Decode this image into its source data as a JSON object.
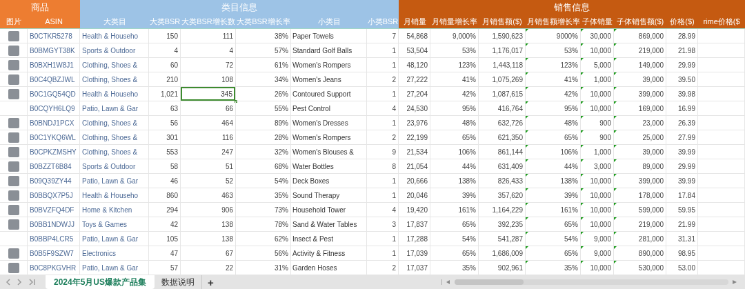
{
  "header_groups": [
    {
      "title": "商品",
      "color": "#ed7d31",
      "columns": [
        {
          "label": "图片",
          "kind": "photo"
        },
        {
          "label": "ASIN",
          "kind": "link_text"
        }
      ]
    },
    {
      "title": "类目信息",
      "color": "#9dc3e6",
      "columns": [
        {
          "label": "大类目",
          "kind": "link_text"
        },
        {
          "label": "大类BSR",
          "kind": "number"
        },
        {
          "label": "大类BSR增长数",
          "kind": "number"
        },
        {
          "label": "大类BSR增长率",
          "kind": "number"
        },
        {
          "label": "小类目",
          "kind": "text"
        },
        {
          "label": "小类BSR",
          "kind": "number"
        }
      ]
    },
    {
      "title": "销售信息",
      "color": "#c55a11",
      "columns": [
        {
          "label": "月销量",
          "kind": "number"
        },
        {
          "label": "月销量增长率",
          "kind": "number"
        },
        {
          "label": "月销售额($)",
          "kind": "number"
        },
        {
          "label": "月销售额增长率",
          "kind": "flagged_number"
        },
        {
          "label": "子体销量",
          "kind": "flagged_number"
        },
        {
          "label": "子体销售额($)",
          "kind": "flagged_number"
        },
        {
          "label": "价格($)",
          "kind": "number"
        },
        {
          "label": "rime价格($",
          "kind": "number"
        }
      ]
    }
  ],
  "rows": [
    {
      "photo": true,
      "cells": [
        {
          "text": "B0CTKR5278",
          "selected": false
        },
        {
          "text": "Health & Househo",
          "selected": false
        },
        {
          "text": "150",
          "selected": false
        },
        {
          "text": "111",
          "selected": false
        },
        {
          "text": "38%",
          "selected": false
        },
        {
          "text": "Paper Towels",
          "selected": false
        },
        {
          "text": "7",
          "selected": false
        },
        {
          "text": "54,868",
          "selected": false
        },
        {
          "text": "9,000%",
          "selected": false
        },
        {
          "text": "1,590,623",
          "selected": false
        },
        {
          "text": "9000%",
          "selected": false
        },
        {
          "text": "30,000",
          "selected": false
        },
        {
          "text": "869,000",
          "selected": false
        },
        {
          "text": "28.99",
          "selected": false
        }
      ]
    },
    {
      "photo": true,
      "cells": [
        {
          "text": "B0BMGYT38K",
          "selected": false
        },
        {
          "text": "Sports & Outdoor",
          "selected": false
        },
        {
          "text": "4",
          "selected": false
        },
        {
          "text": "4",
          "selected": false
        },
        {
          "text": "57%",
          "selected": false
        },
        {
          "text": "Standard Golf Balls",
          "selected": false
        },
        {
          "text": "1",
          "selected": false
        },
        {
          "text": "53,504",
          "selected": false
        },
        {
          "text": "53%",
          "selected": false
        },
        {
          "text": "1,176,017",
          "selected": false
        },
        {
          "text": "53%",
          "selected": false
        },
        {
          "text": "10,000",
          "selected": false
        },
        {
          "text": "219,000",
          "selected": false
        },
        {
          "text": "21.98",
          "selected": false
        }
      ]
    },
    {
      "photo": true,
      "cells": [
        {
          "text": "B0BXH1W8J1",
          "selected": false
        },
        {
          "text": "Clothing, Shoes &",
          "selected": false
        },
        {
          "text": "60",
          "selected": false
        },
        {
          "text": "72",
          "selected": false
        },
        {
          "text": "61%",
          "selected": false
        },
        {
          "text": "Women's Rompers",
          "selected": false
        },
        {
          "text": "1",
          "selected": false
        },
        {
          "text": "48,120",
          "selected": false
        },
        {
          "text": "123%",
          "selected": false
        },
        {
          "text": "1,443,118",
          "selected": false
        },
        {
          "text": "123%",
          "selected": false
        },
        {
          "text": "5,000",
          "selected": false
        },
        {
          "text": "149,000",
          "selected": false
        },
        {
          "text": "29.99",
          "selected": false
        }
      ]
    },
    {
      "photo": true,
      "cells": [
        {
          "text": "B0C4QBZJWL",
          "selected": false
        },
        {
          "text": "Clothing, Shoes &",
          "selected": false
        },
        {
          "text": "210",
          "selected": false
        },
        {
          "text": "108",
          "selected": false
        },
        {
          "text": "34%",
          "selected": false
        },
        {
          "text": "Women's Jeans",
          "selected": false
        },
        {
          "text": "2",
          "selected": false
        },
        {
          "text": "27,222",
          "selected": false
        },
        {
          "text": "41%",
          "selected": false
        },
        {
          "text": "1,075,269",
          "selected": false
        },
        {
          "text": "41%",
          "selected": false
        },
        {
          "text": "1,000",
          "selected": false
        },
        {
          "text": "39,000",
          "selected": false
        },
        {
          "text": "39.50",
          "selected": false
        }
      ]
    },
    {
      "photo": true,
      "cells": [
        {
          "text": "B0C1GQ54QD",
          "selected": false
        },
        {
          "text": "Health & Househo",
          "selected": false
        },
        {
          "text": "1,021",
          "selected": false
        },
        {
          "text": "345",
          "selected": true
        },
        {
          "text": "26%",
          "selected": false
        },
        {
          "text": "Contoured Support",
          "selected": false
        },
        {
          "text": "1",
          "selected": false
        },
        {
          "text": "27,204",
          "selected": false
        },
        {
          "text": "42%",
          "selected": false
        },
        {
          "text": "1,087,615",
          "selected": false
        },
        {
          "text": "42%",
          "selected": false
        },
        {
          "text": "10,000",
          "selected": false
        },
        {
          "text": "399,000",
          "selected": false
        },
        {
          "text": "39.98",
          "selected": false
        }
      ]
    },
    {
      "photo": false,
      "cells": [
        {
          "text": "B0CQYH6LQ9",
          "selected": false
        },
        {
          "text": "Patio, Lawn & Gar",
          "selected": false
        },
        {
          "text": "63",
          "selected": false
        },
        {
          "text": "66",
          "selected": false
        },
        {
          "text": "55%",
          "selected": false
        },
        {
          "text": "Pest Control",
          "selected": false
        },
        {
          "text": "4",
          "selected": false
        },
        {
          "text": "24,530",
          "selected": false
        },
        {
          "text": "95%",
          "selected": false
        },
        {
          "text": "416,764",
          "selected": false
        },
        {
          "text": "95%",
          "selected": false
        },
        {
          "text": "10,000",
          "selected": false
        },
        {
          "text": "169,000",
          "selected": false
        },
        {
          "text": "16.99",
          "selected": false
        }
      ]
    },
    {
      "photo": true,
      "cells": [
        {
          "text": "B0BNDJ1PCX",
          "selected": false
        },
        {
          "text": "Clothing, Shoes &",
          "selected": false
        },
        {
          "text": "56",
          "selected": false
        },
        {
          "text": "464",
          "selected": false
        },
        {
          "text": "89%",
          "selected": false
        },
        {
          "text": "Women's Dresses",
          "selected": false
        },
        {
          "text": "1",
          "selected": false
        },
        {
          "text": "23,976",
          "selected": false
        },
        {
          "text": "48%",
          "selected": false
        },
        {
          "text": "632,726",
          "selected": false
        },
        {
          "text": "48%",
          "selected": false
        },
        {
          "text": "900",
          "selected": false
        },
        {
          "text": "23,000",
          "selected": false
        },
        {
          "text": "26.39",
          "selected": false
        }
      ]
    },
    {
      "photo": true,
      "cells": [
        {
          "text": "B0C1YKQ6WL",
          "selected": false
        },
        {
          "text": "Clothing, Shoes &",
          "selected": false
        },
        {
          "text": "301",
          "selected": false
        },
        {
          "text": "116",
          "selected": false
        },
        {
          "text": "28%",
          "selected": false
        },
        {
          "text": "Women's Rompers",
          "selected": false
        },
        {
          "text": "2",
          "selected": false
        },
        {
          "text": "22,199",
          "selected": false
        },
        {
          "text": "65%",
          "selected": false
        },
        {
          "text": "621,350",
          "selected": false
        },
        {
          "text": "65%",
          "selected": false
        },
        {
          "text": "900",
          "selected": false
        },
        {
          "text": "25,000",
          "selected": false
        },
        {
          "text": "27.99",
          "selected": false
        }
      ]
    },
    {
      "photo": true,
      "cells": [
        {
          "text": "B0CPKZMSHY",
          "selected": false
        },
        {
          "text": "Clothing, Shoes &",
          "selected": false
        },
        {
          "text": "553",
          "selected": false
        },
        {
          "text": "247",
          "selected": false
        },
        {
          "text": "32%",
          "selected": false
        },
        {
          "text": "Women's Blouses &",
          "selected": false
        },
        {
          "text": "9",
          "selected": false
        },
        {
          "text": "21,534",
          "selected": false
        },
        {
          "text": "106%",
          "selected": false
        },
        {
          "text": "861,144",
          "selected": false
        },
        {
          "text": "106%",
          "selected": false
        },
        {
          "text": "1,000",
          "selected": false
        },
        {
          "text": "39,000",
          "selected": false
        },
        {
          "text": "39.99",
          "selected": false
        }
      ]
    },
    {
      "photo": true,
      "cells": [
        {
          "text": "B0BZZT6B84",
          "selected": false
        },
        {
          "text": "Sports & Outdoor",
          "selected": false
        },
        {
          "text": "58",
          "selected": false
        },
        {
          "text": "51",
          "selected": false
        },
        {
          "text": "68%",
          "selected": false
        },
        {
          "text": "Water Bottles",
          "selected": false
        },
        {
          "text": "8",
          "selected": false
        },
        {
          "text": "21,054",
          "selected": false
        },
        {
          "text": "44%",
          "selected": false
        },
        {
          "text": "631,409",
          "selected": false
        },
        {
          "text": "44%",
          "selected": false
        },
        {
          "text": "3,000",
          "selected": false
        },
        {
          "text": "89,000",
          "selected": false
        },
        {
          "text": "29.99",
          "selected": false
        }
      ]
    },
    {
      "photo": true,
      "cells": [
        {
          "text": "B09Q39ZY44",
          "selected": false
        },
        {
          "text": "Patio, Lawn & Gar",
          "selected": false
        },
        {
          "text": "46",
          "selected": false
        },
        {
          "text": "52",
          "selected": false
        },
        {
          "text": "54%",
          "selected": false
        },
        {
          "text": "Deck Boxes",
          "selected": false
        },
        {
          "text": "1",
          "selected": false
        },
        {
          "text": "20,666",
          "selected": false
        },
        {
          "text": "138%",
          "selected": false
        },
        {
          "text": "826,433",
          "selected": false
        },
        {
          "text": "138%",
          "selected": false
        },
        {
          "text": "10,000",
          "selected": false
        },
        {
          "text": "399,000",
          "selected": false
        },
        {
          "text": "39.99",
          "selected": false
        }
      ]
    },
    {
      "photo": true,
      "cells": [
        {
          "text": "B0BBQX7P5J",
          "selected": false
        },
        {
          "text": "Health & Househo",
          "selected": false
        },
        {
          "text": "860",
          "selected": false
        },
        {
          "text": "463",
          "selected": false
        },
        {
          "text": "35%",
          "selected": false
        },
        {
          "text": "Sound Therapy",
          "selected": false
        },
        {
          "text": "1",
          "selected": false
        },
        {
          "text": "20,046",
          "selected": false
        },
        {
          "text": "39%",
          "selected": false
        },
        {
          "text": "357,620",
          "selected": false
        },
        {
          "text": "39%",
          "selected": false
        },
        {
          "text": "10,000",
          "selected": false
        },
        {
          "text": "178,000",
          "selected": false
        },
        {
          "text": "17.84",
          "selected": false
        }
      ]
    },
    {
      "photo": true,
      "cells": [
        {
          "text": "B0BVZFQ4DF",
          "selected": false
        },
        {
          "text": "Home & Kitchen",
          "selected": false
        },
        {
          "text": "294",
          "selected": false
        },
        {
          "text": "906",
          "selected": false
        },
        {
          "text": "73%",
          "selected": false
        },
        {
          "text": "Household Tower",
          "selected": false
        },
        {
          "text": "4",
          "selected": false
        },
        {
          "text": "19,420",
          "selected": false
        },
        {
          "text": "161%",
          "selected": false
        },
        {
          "text": "1,164,229",
          "selected": false
        },
        {
          "text": "161%",
          "selected": false
        },
        {
          "text": "10,000",
          "selected": false
        },
        {
          "text": "599,000",
          "selected": false
        },
        {
          "text": "59.95",
          "selected": false
        }
      ]
    },
    {
      "photo": true,
      "cells": [
        {
          "text": "B0BB1NDWJJ",
          "selected": false
        },
        {
          "text": "Toys & Games",
          "selected": false
        },
        {
          "text": "42",
          "selected": false
        },
        {
          "text": "138",
          "selected": false
        },
        {
          "text": "78%",
          "selected": false
        },
        {
          "text": "Sand & Water Tables",
          "selected": false
        },
        {
          "text": "3",
          "selected": false
        },
        {
          "text": "17,837",
          "selected": false
        },
        {
          "text": "65%",
          "selected": false
        },
        {
          "text": "392,235",
          "selected": false
        },
        {
          "text": "65%",
          "selected": false
        },
        {
          "text": "10,000",
          "selected": false
        },
        {
          "text": "219,000",
          "selected": false
        },
        {
          "text": "21.99",
          "selected": false
        }
      ]
    },
    {
      "photo": false,
      "cells": [
        {
          "text": "B0BBP4LCR5",
          "selected": false
        },
        {
          "text": "Patio, Lawn & Gar",
          "selected": false
        },
        {
          "text": "105",
          "selected": false
        },
        {
          "text": "138",
          "selected": false
        },
        {
          "text": "62%",
          "selected": false
        },
        {
          "text": "Insect & Pest",
          "selected": false
        },
        {
          "text": "1",
          "selected": false
        },
        {
          "text": "17,288",
          "selected": false
        },
        {
          "text": "54%",
          "selected": false
        },
        {
          "text": "541,287",
          "selected": false
        },
        {
          "text": "54%",
          "selected": false
        },
        {
          "text": "9,000",
          "selected": false
        },
        {
          "text": "281,000",
          "selected": false
        },
        {
          "text": "31.31",
          "selected": false
        }
      ]
    },
    {
      "photo": true,
      "cells": [
        {
          "text": "B0B5F9SZW7",
          "selected": false
        },
        {
          "text": "Electronics",
          "selected": false
        },
        {
          "text": "47",
          "selected": false
        },
        {
          "text": "67",
          "selected": false
        },
        {
          "text": "56%",
          "selected": false
        },
        {
          "text": "Activity & Fitness",
          "selected": false
        },
        {
          "text": "1",
          "selected": false
        },
        {
          "text": "17,039",
          "selected": false
        },
        {
          "text": "65%",
          "selected": false
        },
        {
          "text": "1,686,009",
          "selected": false
        },
        {
          "text": "65%",
          "selected": false
        },
        {
          "text": "9,000",
          "selected": false
        },
        {
          "text": "890,000",
          "selected": false
        },
        {
          "text": "98.95",
          "selected": false
        }
      ]
    },
    {
      "photo": true,
      "cells": [
        {
          "text": "B0C8PKGVHR",
          "selected": false
        },
        {
          "text": "Patio, Lawn & Gar",
          "selected": false
        },
        {
          "text": "57",
          "selected": false
        },
        {
          "text": "22",
          "selected": false
        },
        {
          "text": "31%",
          "selected": false
        },
        {
          "text": "Garden Hoses",
          "selected": false
        },
        {
          "text": "2",
          "selected": false
        },
        {
          "text": "17,037",
          "selected": false
        },
        {
          "text": "35%",
          "selected": false
        },
        {
          "text": "902,961",
          "selected": false
        },
        {
          "text": "35%",
          "selected": false
        },
        {
          "text": "10,000",
          "selected": false
        },
        {
          "text": "530,000",
          "selected": false
        },
        {
          "text": "53.00",
          "selected": false
        }
      ]
    }
  ],
  "sheet_tabs": [
    {
      "label": "2024年5月US爆款产品集",
      "selected": true
    },
    {
      "label": "数据说明",
      "selected": false
    }
  ],
  "add_sheet": "+"
}
